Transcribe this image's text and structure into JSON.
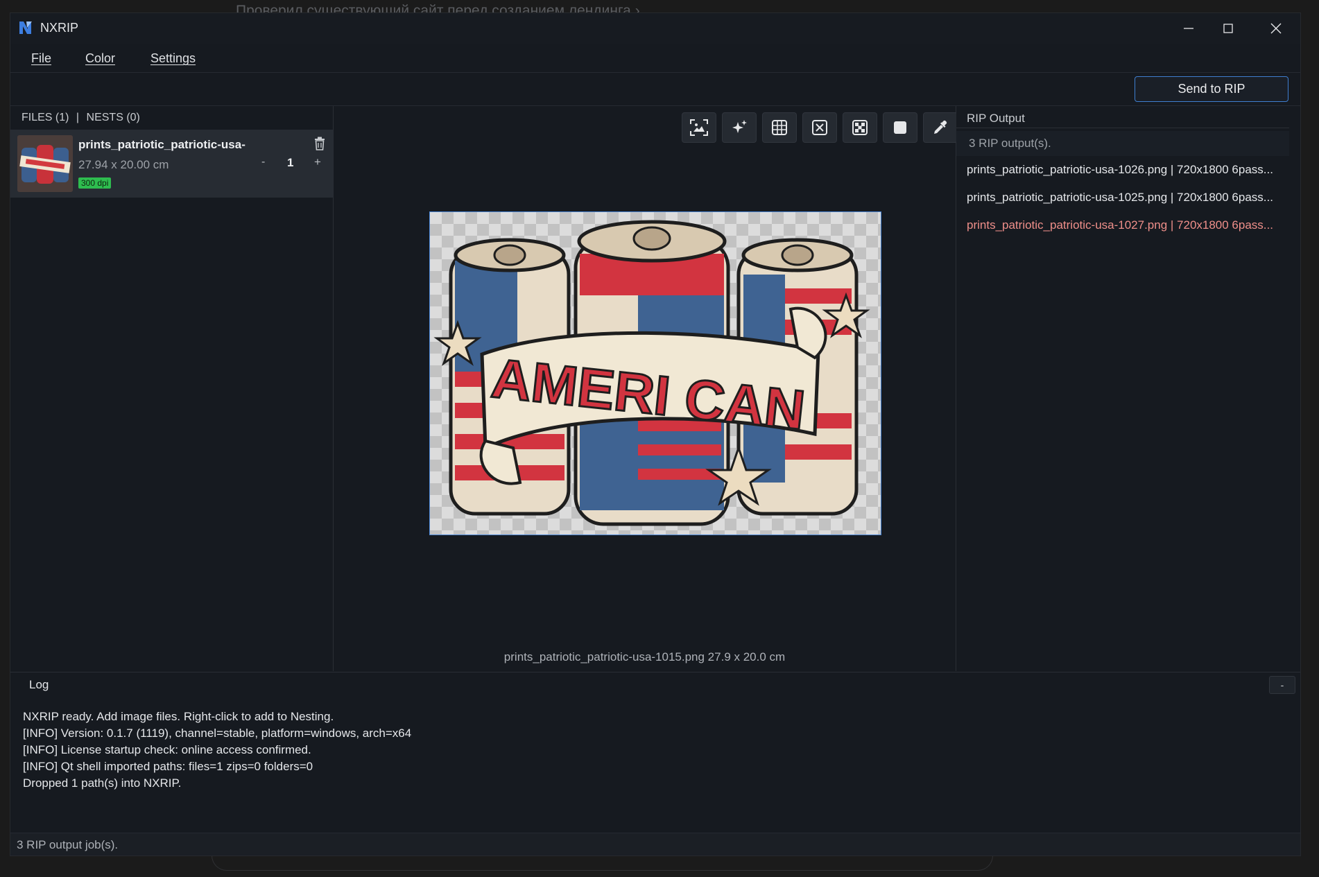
{
  "background": {
    "breadcrumb": "Проверил существующий сайт перед созданием лендинга"
  },
  "window": {
    "title": "NXRIP"
  },
  "menu": {
    "file": "File",
    "color": "Color",
    "settings": "Settings"
  },
  "toolbar": {
    "send_label": "Send to RIP"
  },
  "files_panel": {
    "files_tab": "FILES (1)",
    "separator": "|",
    "nests_tab": "NESTS (0)",
    "items": [
      {
        "name": "prints_patriotic_patriotic-usa-",
        "dimensions": "27.94 x 20.00 cm",
        "dpi": "300 dpi",
        "quantity": "1",
        "minus": "-",
        "plus": "+"
      }
    ]
  },
  "preview": {
    "tools": [
      "fit-to-view",
      "enhance",
      "grid",
      "remove-background",
      "checkerboard",
      "solid-background",
      "eyedropper"
    ],
    "artwork_text": "AMERI CAN",
    "caption": "prints_patriotic_patriotic-usa-1015.png  27.9 x 20.0 cm"
  },
  "rip_output": {
    "title": "RIP Output",
    "count": "3 RIP output(s).",
    "items": [
      {
        "text": "prints_patriotic_patriotic-usa-1026.png | 720x1800 6pass...",
        "status": "ok"
      },
      {
        "text": "prints_patriotic_patriotic-usa-1025.png | 720x1800 6pass...",
        "status": "ok"
      },
      {
        "text": "prints_patriotic_patriotic-usa-1027.png | 720x1800 6pass...",
        "status": "error"
      }
    ]
  },
  "log": {
    "title": "Log",
    "collapse": "-",
    "lines": [
      "NXRIP ready. Add image files. Right-click to add to Nesting.",
      "[INFO] Version: 0.1.7 (1119), channel=stable, platform=windows, arch=x64",
      "[INFO] License startup check: online access confirmed.",
      "[INFO] Qt shell imported paths: files=1 zips=0 folders=0",
      "Dropped 1 path(s) into NXRIP."
    ]
  },
  "status": {
    "text": "3 RIP output job(s)."
  },
  "colors": {
    "accent": "#3f7fd1",
    "error": "#ef8f8a",
    "dpi_badge": "#2ebd4f"
  }
}
